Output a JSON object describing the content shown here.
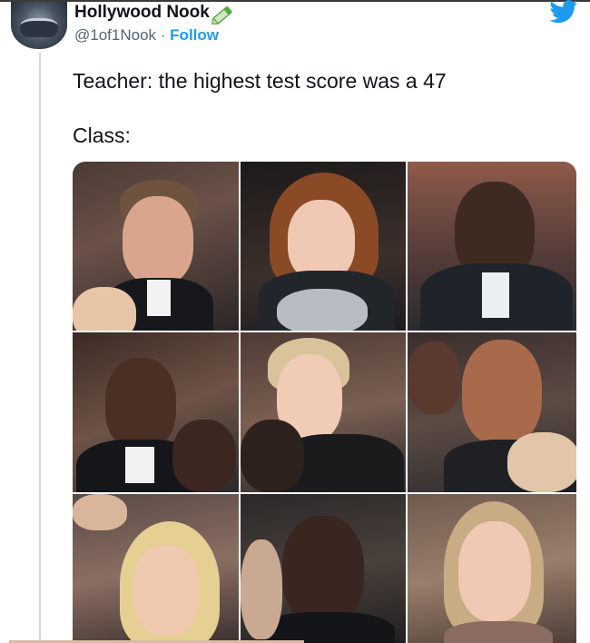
{
  "tweet": {
    "display_name": "Hollywood Nook",
    "verified_icon": "green-pencil-badge-icon",
    "handle": "@1of1Nook",
    "separator": "·",
    "follow_label": "Follow",
    "text_line1": "Teacher: the highest test score was a 47",
    "text_line2": "Class:",
    "brand_icon": "twitter-bird-icon",
    "brand_color": "#1d9bf0"
  },
  "media": {
    "layout": "3x3 photo grid of shocked audience faces",
    "cells": 9
  }
}
